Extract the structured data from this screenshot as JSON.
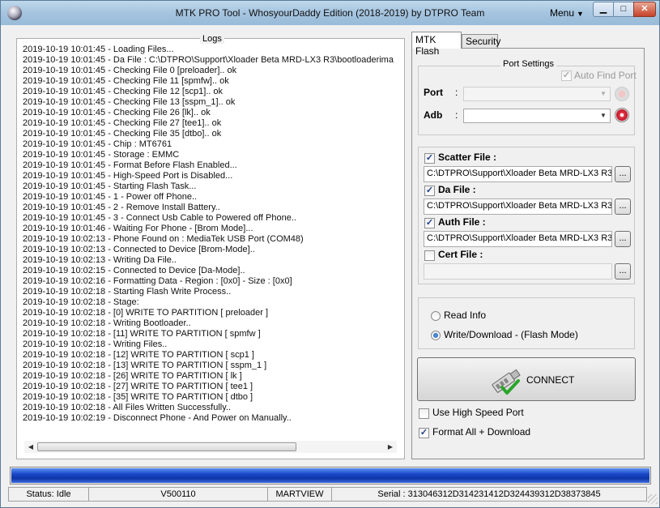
{
  "window": {
    "title": "MTK PRO Tool - WhosyourDaddy Edition (2018-2019) by DTPRO Team",
    "menu_label": "Menu",
    "minimize": "▁",
    "maximize": "□",
    "close": "✕"
  },
  "logs": {
    "legend": "Logs",
    "lines": [
      "2019-10-19 10:01:45 - Loading Files...",
      "2019-10-19 10:01:45 - Da File : C:\\DTPRO\\Support\\Xloader Beta MRD-LX3 R3\\bootloaderima",
      "2019-10-19 10:01:45 - Checking File 0 [preloader].. ok",
      "2019-10-19 10:01:45 - Checking File 11 [spmfw].. ok",
      "2019-10-19 10:01:45 - Checking File 12 [scp1].. ok",
      "2019-10-19 10:01:45 - Checking File 13 [sspm_1].. ok",
      "2019-10-19 10:01:45 - Checking File 26 [lk].. ok",
      "2019-10-19 10:01:45 - Checking File 27 [tee1].. ok",
      "2019-10-19 10:01:45 - Checking File 35 [dtbo].. ok",
      "2019-10-19 10:01:45 - Chip : MT6761",
      "2019-10-19 10:01:45 - Storage : EMMC",
      "2019-10-19 10:01:45 - Format Before Flash Enabled...",
      "2019-10-19 10:01:45 - High-Speed Port is Disabled...",
      "2019-10-19 10:01:45 - Starting Flash Task...",
      "2019-10-19 10:01:45 - 1 - Power off Phone..",
      "2019-10-19 10:01:45 - 2 - Remove Install Battery..",
      "2019-10-19 10:01:45 - 3 - Connect Usb Cable to Powered off Phone..",
      "2019-10-19 10:01:46 - Waiting For Phone - [Brom Mode]...",
      "2019-10-19 10:02:13 - Phone Found on : MediaTek USB Port (COM48)",
      "2019-10-19 10:02:13 - Connected to Device [Brom-Mode]..",
      "2019-10-19 10:02:13 - Writing Da File..",
      "2019-10-19 10:02:15 - Connected to Device [Da-Mode]..",
      "2019-10-19 10:02:16 - Formatting Data - Region : [0x0] - Size : [0x0]",
      "2019-10-19 10:02:18 - Starting Flash Write Process..",
      "2019-10-19 10:02:18 - Stage:",
      "2019-10-19 10:02:18 - [0] WRITE TO PARTITION [ preloader ]",
      "2019-10-19 10:02:18 - Writing Bootloader..",
      "2019-10-19 10:02:18 - [11] WRITE TO PARTITION [ spmfw ]",
      "2019-10-19 10:02:18 - Writing Files..",
      "2019-10-19 10:02:18 - [12] WRITE TO PARTITION [ scp1 ]",
      "2019-10-19 10:02:18 - [13] WRITE TO PARTITION [ sspm_1 ]",
      "2019-10-19 10:02:18 - [26] WRITE TO PARTITION [ lk ]",
      "2019-10-19 10:02:18 - [27] WRITE TO PARTITION [ tee1 ]",
      "2019-10-19 10:02:18 - [35] WRITE TO PARTITION [ dtbo ]",
      "2019-10-19 10:02:18 - All Files Written Successfully..",
      "2019-10-19 10:02:19 - Disconnect Phone - And Power on Manually.."
    ]
  },
  "tabs": [
    {
      "label": "MTK Flash",
      "selected": true
    },
    {
      "label": "Security",
      "selected": false
    }
  ],
  "port_settings": {
    "legend": "Port Settings",
    "auto_find_label": "Auto Find Port",
    "auto_find_checked": true,
    "port_label": "Port",
    "port_value": "",
    "adb_label": "Adb",
    "adb_value": "",
    "sep": ":"
  },
  "files": {
    "scatter": {
      "label": "Scatter File :",
      "checked": true,
      "path": "C:\\DTPRO\\Support\\Xloader Beta MRD-LX3 R3"
    },
    "da": {
      "label": "Da File :",
      "checked": true,
      "path": "C:\\DTPRO\\Support\\Xloader Beta MRD-LX3 R3"
    },
    "auth": {
      "label": "Auth File :",
      "checked": true,
      "path": "C:\\DTPRO\\Support\\Xloader Beta MRD-LX3 R3"
    },
    "cert": {
      "label": "Cert File :",
      "checked": false,
      "path": ""
    },
    "browse_label": "..."
  },
  "mode": {
    "read_info_label": "Read Info",
    "write_label": "Write/Download - (Flash Mode)",
    "selected": "write"
  },
  "connect_label": "CONNECT",
  "options": {
    "high_speed_label": "Use High Speed Port",
    "high_speed_checked": false,
    "format_all_label": "Format All + Download",
    "format_all_checked": true
  },
  "progress": {
    "fraction": 1.0
  },
  "status": {
    "status": "Status: Idle",
    "version": "V500110",
    "device": "MARTVIEW",
    "serial": "Serial : 313046312D314231412D324439312D38373845"
  },
  "colors": {
    "progress_fill": "#1a47c8",
    "close_button": "#c6432b",
    "check_mark": "#1e3f8a"
  }
}
